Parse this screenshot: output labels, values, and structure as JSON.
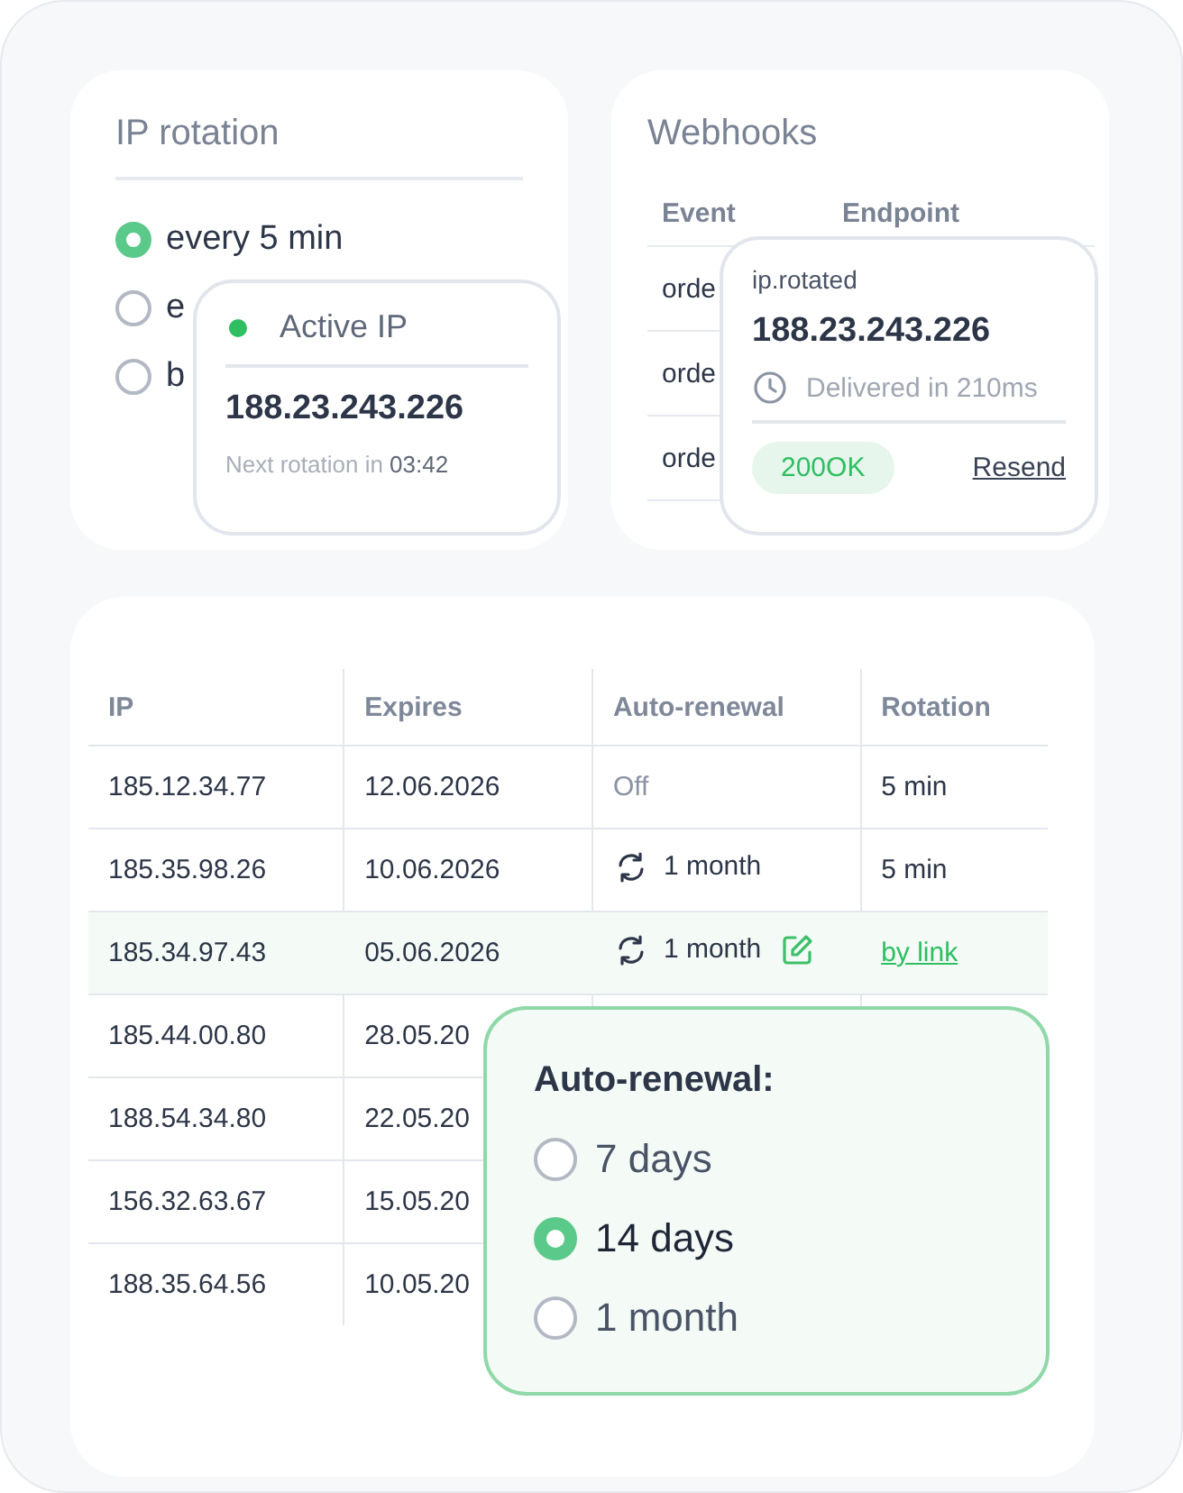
{
  "ip_rotation": {
    "title": "IP rotation",
    "options": [
      {
        "label": "every 5 min",
        "selected": true
      },
      {
        "label": "e",
        "selected": false
      },
      {
        "label": "b",
        "selected": false
      }
    ]
  },
  "active_ip": {
    "label": "Active IP",
    "address": "188.23.243.226",
    "next_label": "Next rotation in",
    "countdown": "03:42"
  },
  "webhooks": {
    "title": "Webhooks",
    "columns": [
      "Event",
      "Endpoint"
    ],
    "rows": [
      {
        "event": "orde"
      },
      {
        "event": "orde"
      },
      {
        "event": "orde"
      }
    ]
  },
  "webhook_popup": {
    "event": "ip.rotated",
    "address": "188.23.243.226",
    "delivery": "Delivered in 210ms",
    "status": "200OK",
    "action": "Resend"
  },
  "ips_table": {
    "columns": [
      "IP",
      "Expires",
      "Auto-renewal",
      "Rotation"
    ],
    "rows": [
      {
        "ip": "185.12.34.77",
        "expires": "12.06.2026",
        "renewal": {
          "kind": "off",
          "text": "Off"
        },
        "rotation": {
          "kind": "plain",
          "text": "5 min"
        },
        "selected": false
      },
      {
        "ip": "185.35.98.26",
        "expires": "10.06.2026",
        "renewal": {
          "kind": "auto",
          "text": "1 month"
        },
        "rotation": {
          "kind": "plain",
          "text": "5 min"
        },
        "selected": false
      },
      {
        "ip": "185.34.97.43",
        "expires": "05.06.2026",
        "renewal": {
          "kind": "auto",
          "text": "1 month"
        },
        "rotation": {
          "kind": "link",
          "text": "by link"
        },
        "selected": true
      },
      {
        "ip": "185.44.00.80",
        "expires": "28.05.20",
        "selected": false
      },
      {
        "ip": "188.54.34.80",
        "expires": "22.05.20",
        "selected": false
      },
      {
        "ip": "156.32.63.67",
        "expires": "15.05.20",
        "selected": false
      },
      {
        "ip": "188.35.64.56",
        "expires": "10.05.20",
        "selected": false
      }
    ]
  },
  "renewal_popup": {
    "title": "Auto-renewal:",
    "options": [
      {
        "label": "7 days",
        "selected": false
      },
      {
        "label": "14 days",
        "selected": true
      },
      {
        "label": "1 month",
        "selected": false
      }
    ]
  }
}
